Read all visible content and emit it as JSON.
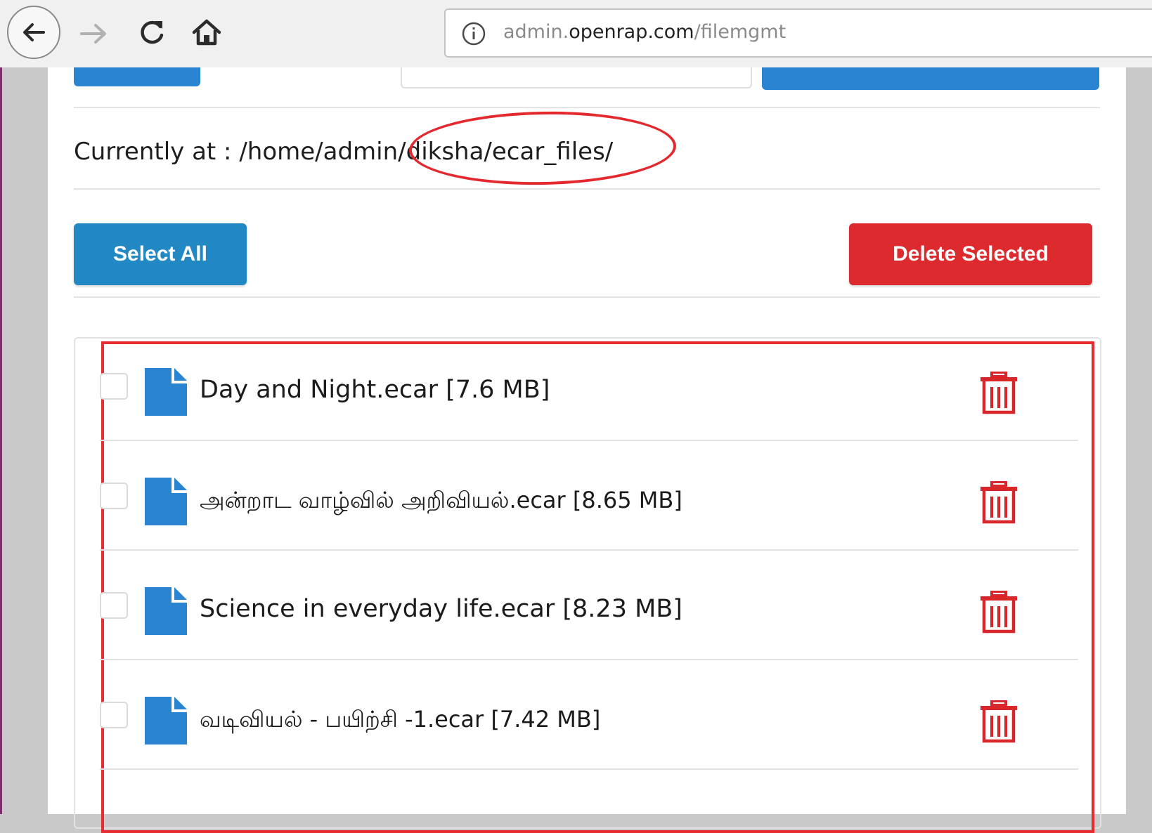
{
  "browser": {
    "url_dim_prefix": "admin.",
    "url_host": "openrap.com",
    "url_path": "/filemgmt"
  },
  "location": {
    "label": "Currently at :",
    "path": "/home/admin/diksha/ecar_files/"
  },
  "actions": {
    "select_all": "Select All",
    "delete_selected": "Delete Selected"
  },
  "files": [
    {
      "name": "Day and Night.ecar [7.6 MB]",
      "checked": false
    },
    {
      "name": "அன்றாட வாழ்வில் அறிவியல்.ecar [8.65 MB]",
      "checked": false
    },
    {
      "name": "Science in everyday life.ecar [8.23 MB]",
      "checked": false
    },
    {
      "name": "வடிவியல் - பயிற்சி -1.ecar [7.42 MB]",
      "checked": false
    }
  ],
  "colors": {
    "primary_blue": "#2288c4",
    "danger_red": "#dc2a2e",
    "annotation_red": "#e3282e",
    "file_icon_blue": "#2a84d2"
  },
  "icons": {
    "back": "arrow-left-icon",
    "forward": "arrow-right-icon",
    "reload": "reload-icon",
    "home": "home-icon",
    "info": "info-icon",
    "file": "file-icon",
    "delete": "trash-icon"
  }
}
